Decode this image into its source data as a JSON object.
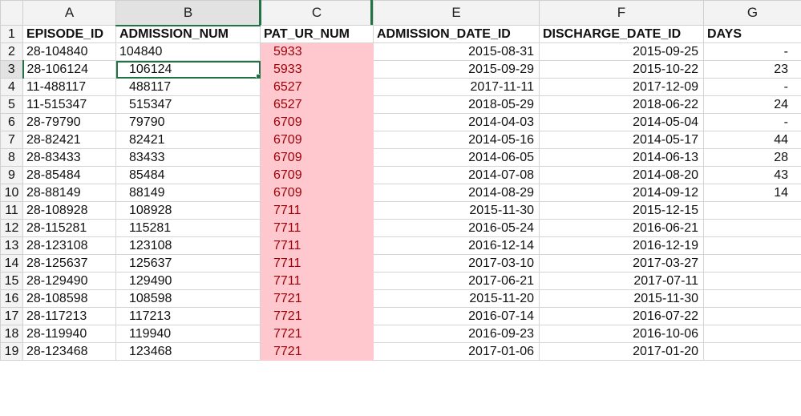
{
  "columns": [
    "A",
    "B",
    "C",
    "E",
    "F",
    "G"
  ],
  "headers": [
    "EPISODE_ID",
    "ADMISSION_NUM",
    "PAT_UR_NUM",
    "ADMISSION_DATE_ID",
    "DISCHARGE_DATE_ID",
    "DAYS"
  ],
  "rows": [
    {
      "n": "2",
      "a": "28-104840",
      "b": "104840",
      "c": "5933",
      "e": "2015-08-31",
      "f": "2015-09-25",
      "g": "-"
    },
    {
      "n": "3",
      "a": "28-106124",
      "b": "106124",
      "c": "5933",
      "e": "2015-09-29",
      "f": "2015-10-22",
      "g": "23"
    },
    {
      "n": "4",
      "a": "11-488117",
      "b": "488117",
      "c": "6527",
      "e": "2017-11-11",
      "f": "2017-12-09",
      "g": "-"
    },
    {
      "n": "5",
      "a": "11-515347",
      "b": "515347",
      "c": "6527",
      "e": "2018-05-29",
      "f": "2018-06-22",
      "g": "24"
    },
    {
      "n": "6",
      "a": "28-79790",
      "b": "79790",
      "c": "6709",
      "e": "2014-04-03",
      "f": "2014-05-04",
      "g": "-"
    },
    {
      "n": "7",
      "a": "28-82421",
      "b": "82421",
      "c": "6709",
      "e": "2014-05-16",
      "f": "2014-05-17",
      "g": "44"
    },
    {
      "n": "8",
      "a": "28-83433",
      "b": "83433",
      "c": "6709",
      "e": "2014-06-05",
      "f": "2014-06-13",
      "g": "28"
    },
    {
      "n": "9",
      "a": "28-85484",
      "b": "85484",
      "c": "6709",
      "e": "2014-07-08",
      "f": "2014-08-20",
      "g": "43"
    },
    {
      "n": "10",
      "a": "28-88149",
      "b": "88149",
      "c": "6709",
      "e": "2014-08-29",
      "f": "2014-09-12",
      "g": "14"
    },
    {
      "n": "11",
      "a": "28-108928",
      "b": "108928",
      "c": "7711",
      "e": "2015-11-30",
      "f": "2015-12-15",
      "g": ""
    },
    {
      "n": "12",
      "a": "28-115281",
      "b": "115281",
      "c": "7711",
      "e": "2016-05-24",
      "f": "2016-06-21",
      "g": ""
    },
    {
      "n": "13",
      "a": "28-123108",
      "b": "123108",
      "c": "7711",
      "e": "2016-12-14",
      "f": "2016-12-19",
      "g": ""
    },
    {
      "n": "14",
      "a": "28-125637",
      "b": "125637",
      "c": "7711",
      "e": "2017-03-10",
      "f": "2017-03-27",
      "g": ""
    },
    {
      "n": "15",
      "a": "28-129490",
      "b": "129490",
      "c": "7711",
      "e": "2017-06-21",
      "f": "2017-07-11",
      "g": ""
    },
    {
      "n": "16",
      "a": "28-108598",
      "b": "108598",
      "c": "7721",
      "e": "2015-11-20",
      "f": "2015-11-30",
      "g": ""
    },
    {
      "n": "17",
      "a": "28-117213",
      "b": "117213",
      "c": "7721",
      "e": "2016-07-14",
      "f": "2016-07-22",
      "g": ""
    },
    {
      "n": "18",
      "a": "28-119940",
      "b": "119940",
      "c": "7721",
      "e": "2016-09-23",
      "f": "2016-10-06",
      "g": ""
    },
    {
      "n": "19",
      "a": "28-123468",
      "b": "123468",
      "c": "7721",
      "e": "2017-01-06",
      "f": "2017-01-20",
      "g": ""
    }
  ],
  "header_row_num": "1",
  "active_cell": "B3",
  "colors": {
    "accent": "#217346",
    "highlight_fill": "#ffc7ce",
    "highlight_text": "#9c0006"
  }
}
